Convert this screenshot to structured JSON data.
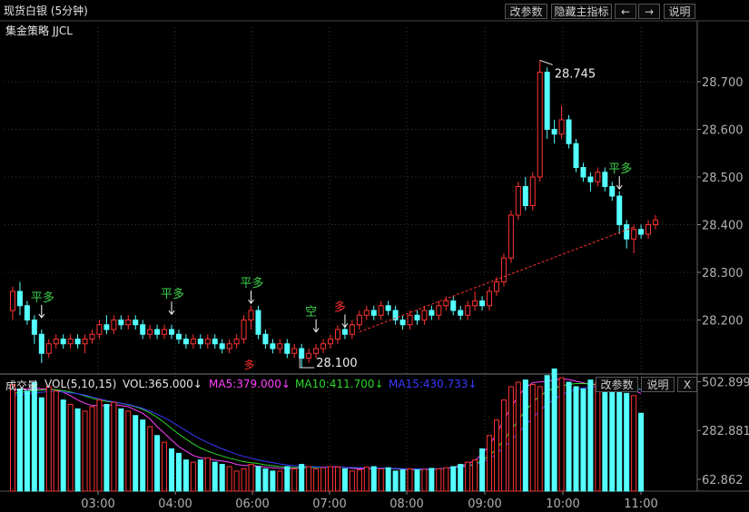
{
  "header": {
    "title": "现货白银 (5分钟)",
    "buttons": [
      "改参数",
      "隐藏主指标",
      "←",
      "→",
      "说明"
    ]
  },
  "strategy_label": "集金策略 JJCL",
  "colors": {
    "up": "#ff3232",
    "down": "#54ffff",
    "trend": "#ff3030",
    "signal_green": "#3cd24b",
    "signal_red": "#ff2d2d",
    "ma5": "#ff40ff",
    "ma10": "#2bd62b",
    "ma15": "#3a3aff",
    "axis": "#b0b0b0",
    "grid": "#333"
  },
  "vol_header": {
    "name": "成交量",
    "indicator": "VOL(5,10,15)",
    "vol": "VOL:365.000",
    "vol_arrow": "↓",
    "ma5": "MA5:379.000",
    "ma5_arrow": "↓",
    "ma10": "MA10:411.700",
    "ma10_arrow": "↓",
    "ma15": "MA15:430.733",
    "ma15_arrow": "↓",
    "buttons": [
      "改参数",
      "说明",
      "X"
    ]
  },
  "chart_data": {
    "type": "candlestick",
    "price_axis": {
      "ticks": [
        "28.700",
        "28.600",
        "28.500",
        "28.400",
        "28.300",
        "28.200"
      ]
    },
    "volume_axis": {
      "ticks": [
        "502.899",
        "282.881",
        "62.862"
      ]
    },
    "time_axis": {
      "ticks": [
        "03:00",
        "04:00",
        "06:00",
        "07:00",
        "08:00",
        "09:00",
        "10:00",
        "11:00"
      ]
    },
    "annotations": {
      "high": "28.745",
      "low": "28.100"
    },
    "signals": [
      {
        "label": "平多",
        "i": 4,
        "price": 28.205,
        "type": "green"
      },
      {
        "label": "平多",
        "i": 22,
        "price": 28.212,
        "type": "green"
      },
      {
        "label": "平多",
        "i": 33,
        "price": 28.235,
        "type": "green"
      },
      {
        "label": "空",
        "i": 42,
        "price": 28.175,
        "type": "green"
      },
      {
        "label": "多",
        "i": 46,
        "price": 28.185,
        "type": "red"
      },
      {
        "label": "平多",
        "i": 84,
        "price": 28.475,
        "type": "green"
      },
      {
        "label": "多",
        "i": 33,
        "price": 28.125,
        "type": "red_below"
      }
    ],
    "trendline": {
      "from": {
        "i": 48,
        "price": 28.175
      },
      "to": {
        "i": 86,
        "price": 28.395
      }
    },
    "candles": [
      [
        28.22,
        28.26,
        28.27,
        28.2
      ],
      [
        28.26,
        28.23,
        28.28,
        28.21
      ],
      [
        28.23,
        28.2,
        28.24,
        28.19
      ],
      [
        28.2,
        28.17,
        28.21,
        28.15
      ],
      [
        28.17,
        28.13,
        28.18,
        28.11
      ],
      [
        28.13,
        28.15,
        28.16,
        28.12
      ],
      [
        28.15,
        28.16,
        28.17,
        28.14
      ],
      [
        28.16,
        28.15,
        28.17,
        28.14
      ],
      [
        28.15,
        28.16,
        28.17,
        28.14
      ],
      [
        28.16,
        28.15,
        28.17,
        28.14
      ],
      [
        28.15,
        28.16,
        28.17,
        28.13
      ],
      [
        28.16,
        28.17,
        28.18,
        28.15
      ],
      [
        28.17,
        28.19,
        28.2,
        28.16
      ],
      [
        28.19,
        28.18,
        28.21,
        28.17
      ],
      [
        28.18,
        28.2,
        28.21,
        28.17
      ],
      [
        28.2,
        28.19,
        28.21,
        28.18
      ],
      [
        28.19,
        28.2,
        28.21,
        28.18
      ],
      [
        28.2,
        28.19,
        28.21,
        28.18
      ],
      [
        28.19,
        28.17,
        28.2,
        28.16
      ],
      [
        28.17,
        28.18,
        28.19,
        28.16
      ],
      [
        28.18,
        28.17,
        28.19,
        28.16
      ],
      [
        28.17,
        28.18,
        28.19,
        28.16
      ],
      [
        28.18,
        28.17,
        28.19,
        28.16
      ],
      [
        28.17,
        28.16,
        28.18,
        28.15
      ],
      [
        28.16,
        28.15,
        28.17,
        28.14
      ],
      [
        28.15,
        28.16,
        28.17,
        28.14
      ],
      [
        28.16,
        28.15,
        28.17,
        28.14
      ],
      [
        28.15,
        28.16,
        28.17,
        28.14
      ],
      [
        28.16,
        28.15,
        28.17,
        28.14
      ],
      [
        28.15,
        28.14,
        28.16,
        28.13
      ],
      [
        28.14,
        28.15,
        28.16,
        28.13
      ],
      [
        28.15,
        28.16,
        28.17,
        28.14
      ],
      [
        28.16,
        28.2,
        28.21,
        28.15
      ],
      [
        28.2,
        28.22,
        28.23,
        28.18
      ],
      [
        28.22,
        28.17,
        28.23,
        28.16
      ],
      [
        28.17,
        28.15,
        28.18,
        28.14
      ],
      [
        28.15,
        28.14,
        28.16,
        28.13
      ],
      [
        28.14,
        28.15,
        28.16,
        28.13
      ],
      [
        28.15,
        28.13,
        28.16,
        28.12
      ],
      [
        28.13,
        28.14,
        28.15,
        28.12
      ],
      [
        28.14,
        28.12,
        28.15,
        28.1
      ],
      [
        28.12,
        28.13,
        28.14,
        28.11
      ],
      [
        28.13,
        28.14,
        28.15,
        28.12
      ],
      [
        28.14,
        28.15,
        28.16,
        28.13
      ],
      [
        28.15,
        28.16,
        28.17,
        28.14
      ],
      [
        28.16,
        28.18,
        28.19,
        28.15
      ],
      [
        28.18,
        28.17,
        28.19,
        28.16
      ],
      [
        28.17,
        28.19,
        28.2,
        28.16
      ],
      [
        28.19,
        28.21,
        28.22,
        28.18
      ],
      [
        28.21,
        28.22,
        28.23,
        28.2
      ],
      [
        28.22,
        28.21,
        28.23,
        28.2
      ],
      [
        28.21,
        28.23,
        28.24,
        28.2
      ],
      [
        28.23,
        28.22,
        28.24,
        28.21
      ],
      [
        28.22,
        28.2,
        28.23,
        28.19
      ],
      [
        28.2,
        28.19,
        28.21,
        28.18
      ],
      [
        28.19,
        28.21,
        28.22,
        28.18
      ],
      [
        28.21,
        28.2,
        28.22,
        28.19
      ],
      [
        28.2,
        28.22,
        28.23,
        28.19
      ],
      [
        28.22,
        28.21,
        28.23,
        28.2
      ],
      [
        28.21,
        28.23,
        28.24,
        28.2
      ],
      [
        28.23,
        28.24,
        28.25,
        28.22
      ],
      [
        28.24,
        28.22,
        28.25,
        28.21
      ],
      [
        28.22,
        28.21,
        28.23,
        28.2
      ],
      [
        28.21,
        28.23,
        28.24,
        28.2
      ],
      [
        28.23,
        28.24,
        28.26,
        28.22
      ],
      [
        28.24,
        28.23,
        28.25,
        28.22
      ],
      [
        28.23,
        28.26,
        28.27,
        28.22
      ],
      [
        28.26,
        28.28,
        28.29,
        28.25
      ],
      [
        28.28,
        28.33,
        28.34,
        28.27
      ],
      [
        28.33,
        28.42,
        28.43,
        28.32
      ],
      [
        28.42,
        28.48,
        28.49,
        28.41
      ],
      [
        28.48,
        28.44,
        28.5,
        28.43
      ],
      [
        28.44,
        28.5,
        28.51,
        28.43
      ],
      [
        28.5,
        28.72,
        28.745,
        28.49
      ],
      [
        28.72,
        28.6,
        28.73,
        28.58
      ],
      [
        28.6,
        28.59,
        28.62,
        28.57
      ],
      [
        28.59,
        28.62,
        28.65,
        28.58
      ],
      [
        28.62,
        28.57,
        28.63,
        28.56
      ],
      [
        28.57,
        28.52,
        28.58,
        28.51
      ],
      [
        28.52,
        28.5,
        28.53,
        28.49
      ],
      [
        28.5,
        28.49,
        28.51,
        28.47
      ],
      [
        28.49,
        28.51,
        28.52,
        28.48
      ],
      [
        28.51,
        28.48,
        28.52,
        28.47
      ],
      [
        28.48,
        28.46,
        28.49,
        28.45
      ],
      [
        28.46,
        28.4,
        28.47,
        28.38
      ],
      [
        28.4,
        28.37,
        28.41,
        28.35
      ],
      [
        28.37,
        28.39,
        28.4,
        28.34
      ],
      [
        28.39,
        28.38,
        28.4,
        28.37
      ],
      [
        28.38,
        28.4,
        28.41,
        28.37
      ],
      [
        28.4,
        28.41,
        28.42,
        28.39
      ]
    ],
    "volumes": [
      490,
      470,
      460,
      500,
      430,
      480,
      460,
      420,
      400,
      380,
      370,
      390,
      420,
      400,
      410,
      380,
      370,
      350,
      330,
      300,
      260,
      230,
      200,
      180,
      150,
      140,
      150,
      160,
      140,
      130,
      120,
      100,
      110,
      130,
      120,
      110,
      100,
      100,
      120,
      110,
      130,
      120,
      110,
      115,
      120,
      118,
      110,
      100,
      105,
      118,
      120,
      110,
      115,
      100,
      105,
      110,
      105,
      108,
      112,
      110,
      115,
      120,
      130,
      140,
      150,
      200,
      260,
      330,
      420,
      480,
      500,
      510,
      490,
      480,
      530,
      560,
      520,
      500,
      480,
      470,
      510,
      500,
      480,
      470,
      460,
      450,
      440,
      360
    ],
    "ma5": [
      460,
      470,
      470,
      475,
      470,
      470,
      465,
      455,
      440,
      420,
      405,
      395,
      395,
      395,
      400,
      395,
      390,
      375,
      360,
      335,
      300,
      270,
      240,
      210,
      190,
      170,
      160,
      155,
      150,
      145,
      140,
      130,
      125,
      125,
      122,
      118,
      115,
      112,
      112,
      112,
      115,
      116,
      117,
      118,
      120,
      119,
      116,
      112,
      110,
      110,
      112,
      113,
      112,
      110,
      108,
      107,
      106,
      107,
      108,
      110,
      113,
      118,
      124,
      132,
      148,
      176,
      216,
      268,
      330,
      388,
      438,
      476,
      498,
      502,
      505,
      510,
      515,
      512,
      505,
      498,
      490,
      488,
      484,
      480,
      478,
      472,
      464,
      450
    ],
    "ma10": [
      450,
      455,
      458,
      462,
      465,
      468,
      466,
      462,
      456,
      448,
      438,
      428,
      420,
      414,
      410,
      405,
      398,
      390,
      378,
      362,
      342,
      318,
      292,
      266,
      244,
      222,
      204,
      190,
      178,
      168,
      158,
      150,
      142,
      138,
      134,
      128,
      124,
      120,
      118,
      116,
      116,
      116,
      116,
      117,
      118,
      118,
      117,
      115,
      114,
      113,
      113,
      113,
      112,
      111,
      110,
      109,
      108,
      108,
      109,
      110,
      112,
      115,
      119,
      124,
      132,
      148,
      170,
      200,
      240,
      284,
      330,
      372,
      410,
      440,
      460,
      474,
      484,
      490,
      494,
      494,
      492,
      490,
      488,
      486,
      484,
      480,
      474,
      468
    ],
    "ma15": [
      440,
      445,
      448,
      452,
      455,
      458,
      458,
      456,
      452,
      448,
      442,
      434,
      426,
      418,
      412,
      406,
      400,
      392,
      382,
      370,
      356,
      340,
      322,
      302,
      282,
      262,
      244,
      228,
      214,
      200,
      188,
      176,
      166,
      158,
      150,
      144,
      138,
      132,
      128,
      124,
      122,
      120,
      119,
      118,
      118,
      118,
      117,
      116,
      115,
      114,
      114,
      113,
      113,
      112,
      111,
      110,
      110,
      110,
      110,
      111,
      112,
      114,
      117,
      121,
      128,
      140,
      156,
      178,
      206,
      238,
      272,
      306,
      340,
      372,
      400,
      424,
      444,
      458,
      468,
      474,
      478,
      480,
      480,
      480,
      478,
      476,
      472,
      466
    ]
  }
}
